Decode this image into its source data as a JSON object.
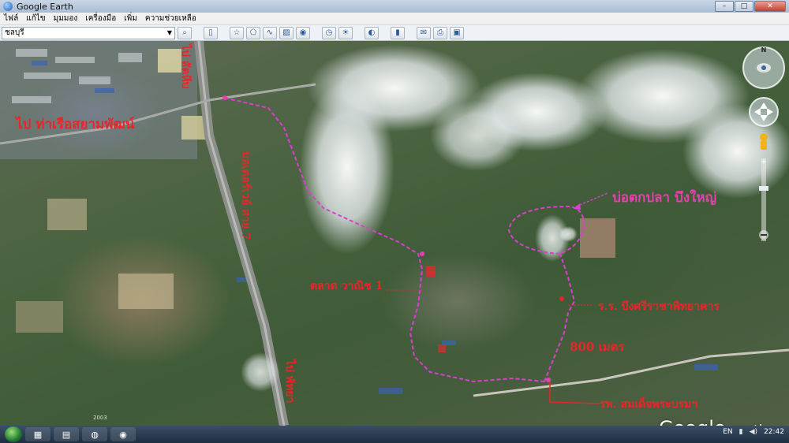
{
  "window": {
    "title": "Google Earth",
    "controls": [
      "–",
      "□",
      "✕"
    ]
  },
  "menu": [
    "ไฟล์",
    "แก้ไข",
    "มุมมอง",
    "เครื่องมือ",
    "เพิ่ม",
    "ความช่วยเหลือ"
  ],
  "search": {
    "value": "ชลบุรี"
  },
  "toolbar_icons": [
    "search-icon",
    "sidebar-icon",
    "placemark-icon",
    "polygon-icon",
    "path-icon",
    "image-overlay-icon",
    "tour-icon",
    "historical-imagery-icon",
    "sun-icon",
    "planets-icon",
    "ruler-icon",
    "email-icon",
    "print-icon",
    "save-image-icon"
  ],
  "labels": {
    "to_sattahip": "ไป สัตหีบ",
    "to_siam_harbor": "ไป ท่าเรือสยามพัฒน์",
    "motorway": "มอเตอร์เวย์ สาย 7",
    "fish_pond": "บ่อตกปลา บึงใหญ่",
    "market": "ตลาด วาณิช 1",
    "school": "ร.ร. บึงศรีราชาพิทยาคาร",
    "distance": "800 เมตร",
    "hospital": "รพ. สมเด็จพระบรมฯ",
    "to_pattaya": "ไป พัทยา"
  },
  "logo": {
    "brand": "Google",
    "suffix": "earth"
  },
  "imagery_date": "2003",
  "taskbar": {
    "language": "EN",
    "time": "22:42",
    "apps": [
      "explorer-icon",
      "folder-icon",
      "chrome-icon",
      "google-earth-icon"
    ]
  },
  "colors": {
    "route": "#d93fd0",
    "label_red": "#e8262a",
    "label_pink": "#e63fb0"
  }
}
